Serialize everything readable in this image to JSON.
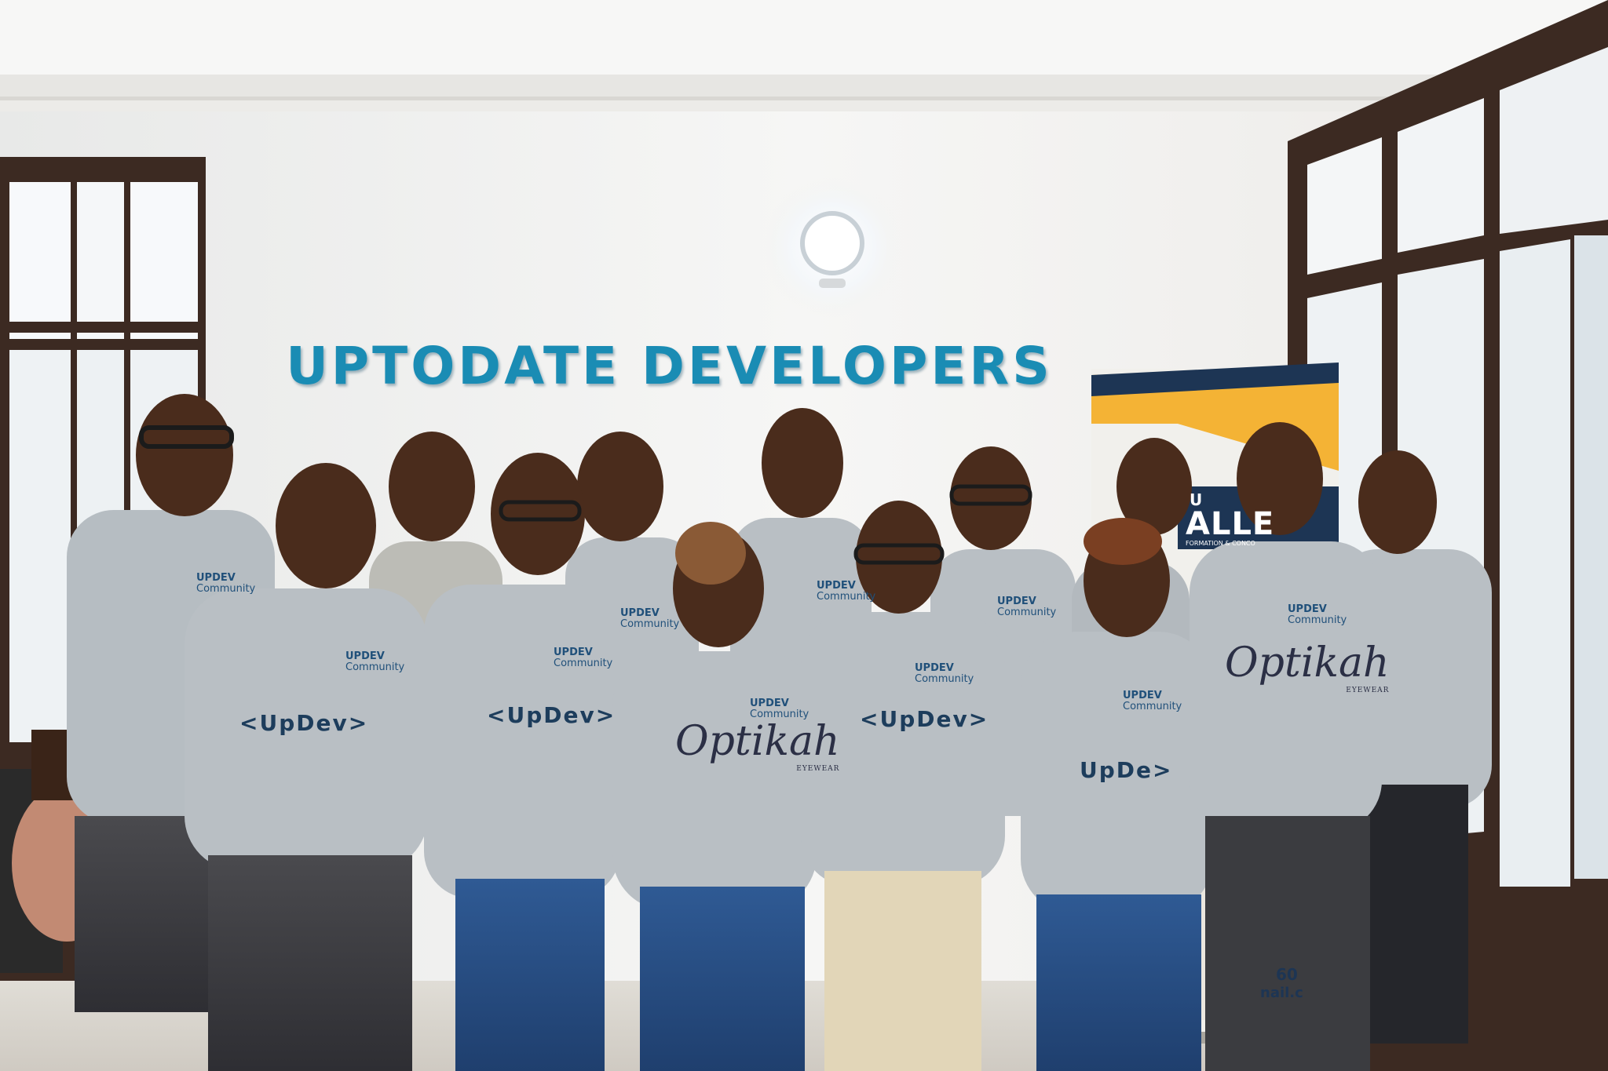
{
  "wall_sign": "UPTODATE DEVELOPERS",
  "shirt": {
    "brand_line1": "UPDEV",
    "brand_line2": "Community",
    "logo": "<UpDev>",
    "logo_short": "UpDe>",
    "sponsor": "Optikah",
    "sponsor_sub": "EYEWEAR"
  },
  "banner": {
    "title_fragment": "ALLE",
    "prefix_fragment": "U",
    "subtitle_fragment": "FORMATION & CONCO",
    "phone_fragment": "60",
    "email_fragment": "nail.c"
  },
  "colors": {
    "wall": "#f3f3f1",
    "sign_text": "#1a8cb4",
    "shirt_gray": "#b9bfc4",
    "skin": "#4a2c1c",
    "window_frame": "#3c2a22",
    "banner_yellow": "#f4b335",
    "banner_navy": "#1d3554"
  }
}
